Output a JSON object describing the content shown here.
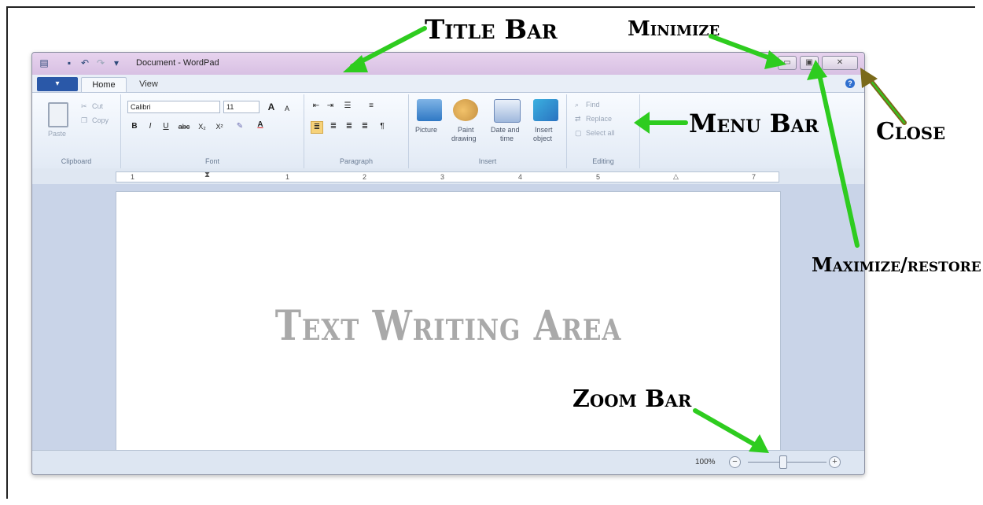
{
  "window": {
    "title": "Document - WordPad",
    "app_button": "▾",
    "tabs": [
      "Home",
      "View"
    ],
    "help": "?",
    "caption_buttons": [
      "▭",
      "▣",
      "✕"
    ]
  },
  "ribbon": {
    "clipboard": {
      "paste": "Paste",
      "cut": "Cut",
      "copy": "Copy",
      "label": "Clipboard"
    },
    "font": {
      "name": "Calibri",
      "size": "11",
      "grow": "A",
      "shrink": "A",
      "bold": "B",
      "italic": "I",
      "underline": "U",
      "strike": "abc",
      "sub": "X₂",
      "sup": "X²",
      "color": "A",
      "label": "Font"
    },
    "paragraph": {
      "label": "Paragraph"
    },
    "insert": {
      "picture": "Picture",
      "paint1": "Paint",
      "paint2": "drawing",
      "date1": "Date and",
      "date2": "time",
      "insert1": "Insert",
      "insert2": "object",
      "label": "Insert"
    },
    "editing": {
      "find": "Find",
      "replace": "Replace",
      "select_all": "Select all",
      "label": "Editing"
    }
  },
  "ruler": {
    "marks": [
      "1",
      "1",
      "2",
      "3",
      "4",
      "5",
      "7"
    ]
  },
  "document": {
    "area_text": "Text Writing Area"
  },
  "status": {
    "zoom": "100%",
    "zoom_minus": "−",
    "zoom_plus": "+"
  },
  "annotations": {
    "title_bar": "Title Bar",
    "minimize": "Minimize",
    "menu_bar": "Menu Bar",
    "close": "Close",
    "maximize": "Maximize/restore",
    "zoom_bar": "Zoom Bar"
  },
  "colors": {
    "arrow": "#2ecc1f",
    "close_arrow": "#7a6a1a",
    "title_bar": "#dcc6e6",
    "app_button": "#2a58a8"
  }
}
